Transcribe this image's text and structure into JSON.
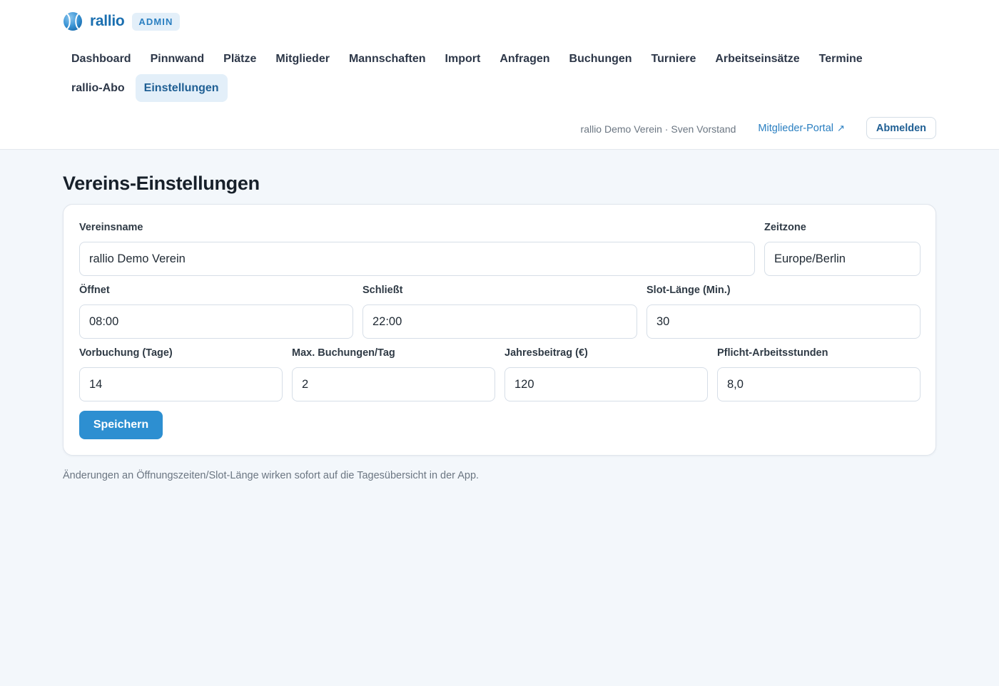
{
  "brand": {
    "name": "rallio",
    "badge": "ADMIN",
    "logo_icon": "tennis-ball-icon",
    "accent_color": "#2d8fd1"
  },
  "nav": {
    "items": [
      {
        "label": "Dashboard",
        "active": false
      },
      {
        "label": "Pinnwand",
        "active": false
      },
      {
        "label": "Plätze",
        "active": false
      },
      {
        "label": "Mitglieder",
        "active": false
      },
      {
        "label": "Mannschaften",
        "active": false
      },
      {
        "label": "Import",
        "active": false
      },
      {
        "label": "Anfragen",
        "active": false
      },
      {
        "label": "Buchungen",
        "active": false
      },
      {
        "label": "Turniere",
        "active": false
      },
      {
        "label": "Arbeitseinsätze",
        "active": false
      },
      {
        "label": "Termine",
        "active": false
      },
      {
        "label": "rallio-Abo",
        "active": false
      },
      {
        "label": "Einstellungen",
        "active": true
      }
    ]
  },
  "userbar": {
    "user_info": "rallio Demo Verein · Sven Vorstand",
    "portal_link": "Mitglieder-Portal",
    "portal_icon": "↗",
    "logout_label": "Abmelden"
  },
  "page": {
    "title": "Vereins-Einstellungen",
    "hint": "Änderungen an Öffnungszeiten/Slot-Länge wirken sofort auf die Tagesübersicht in der App."
  },
  "form": {
    "club_name": {
      "label": "Vereinsname",
      "value": "rallio Demo Verein"
    },
    "timezone": {
      "label": "Zeitzone",
      "value": "Europe/Berlin"
    },
    "opens": {
      "label": "Öffnet",
      "value": "08:00"
    },
    "closes": {
      "label": "Schließt",
      "value": "22:00"
    },
    "slot_length": {
      "label": "Slot-Länge (Min.)",
      "value": "30"
    },
    "advance_days": {
      "label": "Vorbuchung (Tage)",
      "value": "14"
    },
    "max_bookings": {
      "label": "Max. Buchungen/Tag",
      "value": "2"
    },
    "annual_fee": {
      "label": "Jahresbeitrag (€)",
      "value": "120"
    },
    "work_hours": {
      "label": "Pflicht-Arbeitsstunden",
      "value": "8,0"
    },
    "save_label": "Speichern"
  }
}
